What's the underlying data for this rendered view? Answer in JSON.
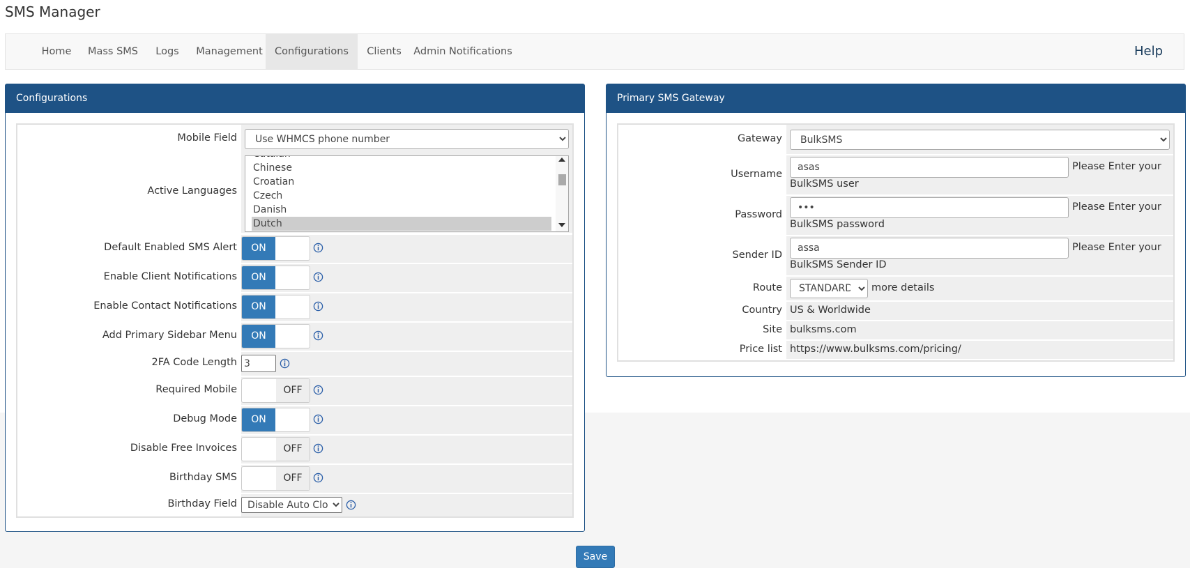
{
  "app": {
    "title": "SMS Manager"
  },
  "nav": {
    "items": [
      {
        "label": "Home",
        "active": false
      },
      {
        "label": "Mass SMS",
        "active": false
      },
      {
        "label": "Logs",
        "active": false
      },
      {
        "label": "Management",
        "active": false
      },
      {
        "label": "Configurations",
        "active": true
      },
      {
        "label": "Clients",
        "active": false
      },
      {
        "label": "Admin Notifications",
        "active": false
      }
    ],
    "help_label": "Help"
  },
  "config": {
    "title": "Configurations",
    "mobile_field": {
      "label": "Mobile Field",
      "value": "Use WHMCS phone number"
    },
    "active_languages": {
      "label": "Active Languages",
      "options": [
        "Catalan",
        "Chinese",
        "Croatian",
        "Czech",
        "Danish",
        "Dutch"
      ],
      "selected": "Dutch"
    },
    "default_enabled_sms_alert": {
      "label": "Default Enabled SMS Alert",
      "state": "ON"
    },
    "enable_client_notifications": {
      "label": "Enable Client Notifications",
      "state": "ON"
    },
    "enable_contact_notifications": {
      "label": "Enable Contact Notifications",
      "state": "ON"
    },
    "add_primary_sidebar_menu": {
      "label": "Add Primary Sidebar Menu",
      "state": "ON"
    },
    "twofa_code_length": {
      "label": "2FA Code Length",
      "value": "3"
    },
    "required_mobile": {
      "label": "Required Mobile",
      "state": "OFF"
    },
    "debug_mode": {
      "label": "Debug Mode",
      "state": "ON"
    },
    "disable_free_invoices": {
      "label": "Disable Free Invoices",
      "state": "OFF"
    },
    "birthday_sms": {
      "label": "Birthday SMS",
      "state": "OFF"
    },
    "birthday_field": {
      "label": "Birthday Field",
      "value": "Disable Auto Close"
    }
  },
  "gateway": {
    "title": "Primary SMS Gateway",
    "gateway": {
      "label": "Gateway",
      "value": "BulkSMS"
    },
    "username": {
      "label": "Username",
      "value": "asas",
      "help_line1": "Please Enter your",
      "help_line2": "BulkSMS user"
    },
    "password": {
      "label": "Password",
      "value": "***",
      "help_line1": "Please Enter your",
      "help_line2": "BulkSMS password"
    },
    "sender_id": {
      "label": "Sender ID",
      "value": "assa",
      "help_line1": "Please Enter your",
      "help_line2": "BulkSMS Sender ID"
    },
    "route": {
      "label": "Route",
      "value": "STANDARD",
      "link": "more details"
    },
    "country": {
      "label": "Country",
      "value": "US & Worldwide"
    },
    "site": {
      "label": "Site",
      "value": "bulksms.com"
    },
    "price_list": {
      "label": "Price list",
      "value": "https://www.bulksms.com/pricing/"
    }
  },
  "actions": {
    "save_label": "Save"
  },
  "colors": {
    "panel_header": "#1e5285",
    "toggle_on": "#337ab7",
    "active_tab": "#e7e7e7"
  }
}
